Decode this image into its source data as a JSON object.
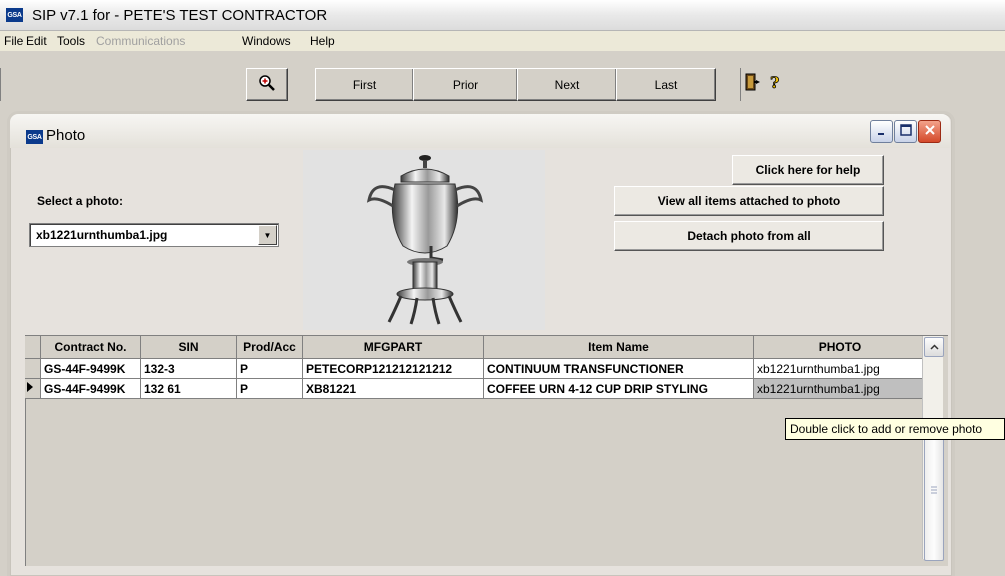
{
  "app": {
    "logo": "GSA",
    "title": "SIP v7.1 for - PETE'S TEST CONTRACTOR"
  },
  "menu": {
    "items": [
      {
        "label": "File",
        "enabled": true
      },
      {
        "label": "Edit",
        "enabled": true
      },
      {
        "label": "Tools",
        "enabled": true
      },
      {
        "label": "Communications",
        "enabled": false
      },
      {
        "label": "Windows",
        "enabled": true
      },
      {
        "label": "Help",
        "enabled": true
      }
    ]
  },
  "toolbar": {
    "zoom_icon": "magnifier-zoom-icon",
    "first_label": "First",
    "prior_label": "Prior",
    "next_label": "Next",
    "last_label": "Last",
    "exit_icon": "exit-door-icon",
    "help_icon": "question-mark-icon"
  },
  "photo_window": {
    "logo": "GSA",
    "title": "Photo",
    "select_label": "Select a photo:",
    "selected_photo": "xb1221urnthumba1.jpg",
    "help_button": "Click here for help",
    "view_all_button": "View all items attached to photo",
    "detach_button": "Detach photo from all"
  },
  "grid": {
    "columns": [
      "Contract No.",
      "SIN",
      "Prod/Acc",
      "MFGPART",
      "Item Name",
      "PHOTO"
    ],
    "rows": [
      {
        "contract": "GS-44F-9499K",
        "sin": "132-3",
        "prodacc": "P",
        "mfgpart": "PETECORP121212121212",
        "item": "CONTINUUM TRANSFUNCTIONER",
        "photo": "xb1221urnthumba1.jpg",
        "current": false
      },
      {
        "contract": "GS-44F-9499K",
        "sin": "132 61",
        "prodacc": "P",
        "mfgpart": "XB81221",
        "item": "COFFEE URN 4-12 CUP DRIP STYLING",
        "photo": "xb1221urnthumba1.jpg",
        "current": true
      }
    ]
  },
  "tooltip": {
    "text": "Double click to add or remove photo"
  }
}
